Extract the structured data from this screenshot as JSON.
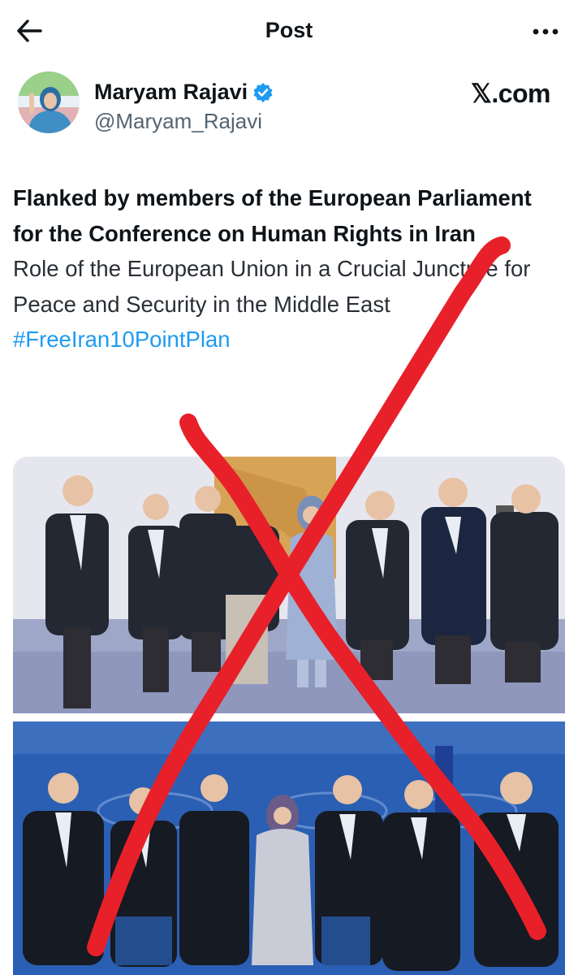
{
  "topbar": {
    "title": "Post",
    "back_icon": "arrow-left-icon",
    "more_icon": "more-horizontal-icon"
  },
  "author": {
    "name": "Maryam Rajavi",
    "handle": "@Maryam_Rajavi",
    "verified": true,
    "verified_color": "#1d9bf0"
  },
  "brand": {
    "label": "𝕏.com"
  },
  "post": {
    "title": "Flanked by members of the European Parliament for the Conference on Human Rights in Iran",
    "body": "Role of the European Union in a Crucial Juncture for Peace and Security in the Middle East",
    "hashtag": "#FreeIran10PointPlan"
  },
  "overlay": {
    "type": "red-x-strike",
    "color": "#e8202a"
  }
}
